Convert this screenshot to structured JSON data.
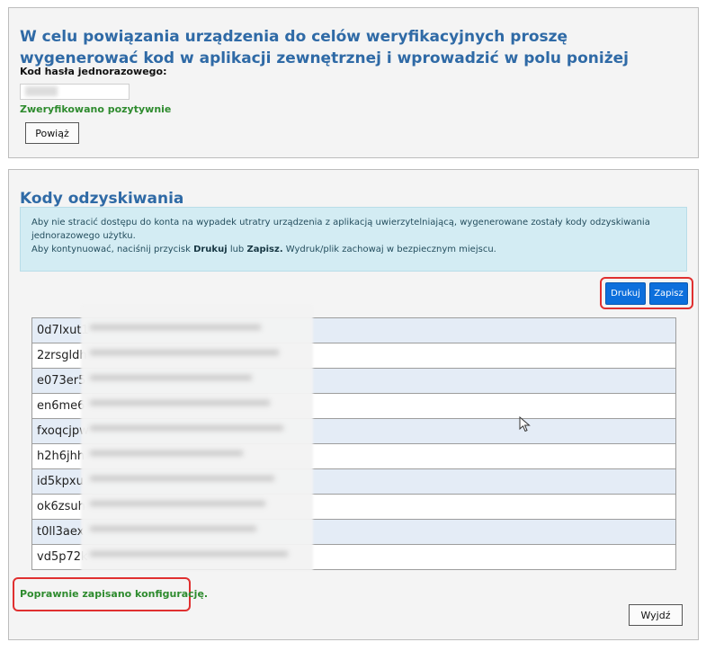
{
  "link_panel": {
    "title": "W celu powiązania urządzenia do celów weryfikacyjnych proszę wygenerować kod w aplikacji zewnętrznej i wprowadzić w polu poniżej",
    "otp_label": "Kod hasła jednorazowego:",
    "otp_value": "",
    "verified_text": "Zweryfikowano pozytywnie",
    "bind_button": "Powiąż"
  },
  "recovery_panel": {
    "title": "Kody odzyskiwania",
    "info_line1": "Aby nie stracić dostępu do konta na wypadek utratry urządzenia z aplikacją uwierzytelniającą, wygenerowane zostały kody odzyskiwania jednorazowego użytku.",
    "info_line2_pre": "Aby kontynuować, naciśnij przycisk ",
    "info_line2_b1": "Drukuj",
    "info_line2_mid": " lub ",
    "info_line2_b2": "Zapisz.",
    "info_line2_post": " Wydruk/plik zachowaj w bezpiecznym miejscu.",
    "print_button": "Drukuj",
    "save_button": "Zapisz",
    "codes": [
      "0d7lxut1",
      "2zrsgldh",
      "e073er5",
      "en6me6",
      "fxoqcjpw",
      "h2h6jhh",
      "id5kpxu",
      "ok6zsuh",
      "t0ll3aex",
      "vd5p72k"
    ],
    "status_text": "Poprawnie zapisano konfigurację.",
    "exit_button": "Wyjdź"
  },
  "colors": {
    "title_blue": "#2f6aa6",
    "success_green": "#2e8b2e",
    "button_blue": "#0d6fdc",
    "highlight_red": "#e03030",
    "info_bg": "#d3ecf3"
  }
}
